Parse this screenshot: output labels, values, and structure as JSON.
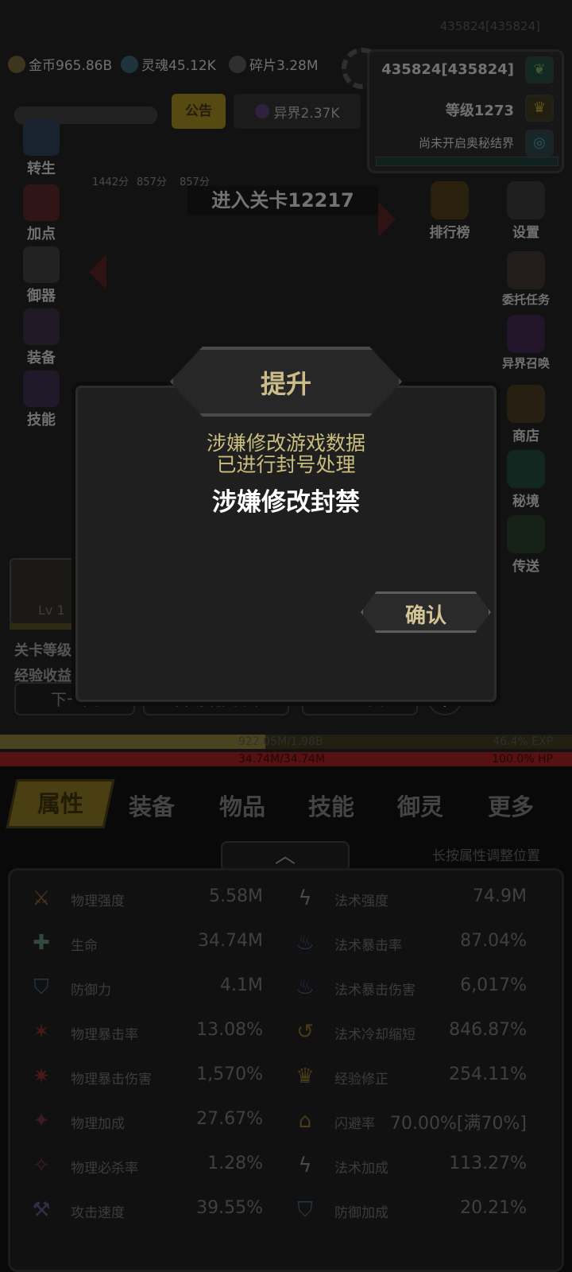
{
  "top": {
    "account_id": "435824[435824]",
    "resources": {
      "gold": "金币965.86B",
      "soul": "灵魂45.12K",
      "shard": "碎片3.28M"
    },
    "player_id": "435824[435824]",
    "level": "等级1273",
    "mystic_status": "尚未开启奥秘结界",
    "notice_tab": "公告",
    "other_world": "异界2.37K"
  },
  "boosts": [
    "1442分",
    "857分",
    "857分"
  ],
  "stage_title": "进入关卡12217",
  "left_menu": [
    "转生",
    "加点",
    "御器",
    "装备",
    "技能"
  ],
  "right_menu": [
    "排行榜",
    "设置",
    "委托任务",
    "异界召唤",
    "商店",
    "秘境",
    "传送"
  ],
  "monster": {
    "level": "Lv 1",
    "stage_level": "关卡等级",
    "exp_gain": "经验收益"
  },
  "nav_buttons": {
    "next": "下一关",
    "auto": "自动跳关:关",
    "prev": "上一关",
    "plus": "+"
  },
  "bars": {
    "exp_text": "922.05M/1.98B",
    "exp_pct": "46.4% EXP",
    "exp_fraction": 0.464,
    "hp_text": "34.74M/34.74M",
    "hp_pct": "100.0% HP",
    "hp_fraction": 1.0
  },
  "tabs": [
    "属性",
    "装备",
    "物品",
    "技能",
    "御灵",
    "更多"
  ],
  "hint": "长按属性调整位置",
  "stats_left": [
    {
      "name": "物理强度",
      "value": "5.58M",
      "icon": "sword-icon"
    },
    {
      "name": "生命",
      "value": "34.74M",
      "icon": "cross-icon"
    },
    {
      "name": "防御力",
      "value": "4.1M",
      "icon": "shield-icon"
    },
    {
      "name": "物理暴击率",
      "value": "13.08%",
      "icon": "crit-icon"
    },
    {
      "name": "物理暴击伤害",
      "value": "1,570%",
      "icon": "crit-damage-icon"
    },
    {
      "name": "物理加成",
      "value": "27.67%",
      "icon": "bonus-icon"
    },
    {
      "name": "物理必杀率",
      "value": "1.28%",
      "icon": "kill-icon"
    },
    {
      "name": "攻击速度",
      "value": "39.55%",
      "icon": "speed-icon"
    }
  ],
  "stats_right": [
    {
      "name": "法术强度",
      "value": "74.9M",
      "icon": "lightning-icon"
    },
    {
      "name": "法术暴击率",
      "value": "87.04%",
      "icon": "flame-icon"
    },
    {
      "name": "法术暴击伤害",
      "value": "6,017%",
      "icon": "flame-icon"
    },
    {
      "name": "法术冷却缩短",
      "value": "846.87%",
      "icon": "cooldown-icon"
    },
    {
      "name": "经验修正",
      "value": "254.11%",
      "icon": "crown-icon"
    },
    {
      "name": "闪避率",
      "value": "70.00%[满70%]",
      "icon": "boot-icon"
    },
    {
      "name": "法术加成",
      "value": "113.27%",
      "icon": "lightning-icon"
    },
    {
      "name": "防御加成",
      "value": "20.21%",
      "icon": "shield-icon"
    }
  ],
  "dialog": {
    "title": "提升",
    "message_line1": "涉嫌修改游戏数据",
    "message_line2": "已进行封号处理",
    "headline": "涉嫌修改封禁",
    "confirm": "确认"
  },
  "colors": {
    "accent_gold": "#cbbd7e",
    "hp_red": "#6a1717",
    "exp_gold": "#5b5226"
  }
}
